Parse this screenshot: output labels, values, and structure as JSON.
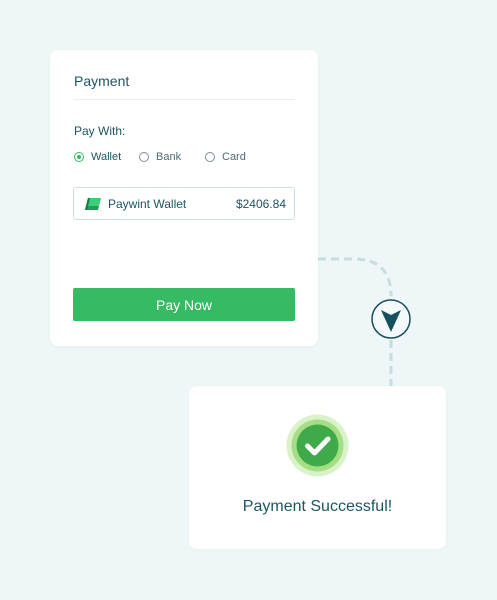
{
  "payment": {
    "title": "Payment",
    "pay_with_label": "Pay With:",
    "methods": [
      {
        "label": "Wallet",
        "selected": true
      },
      {
        "label": "Bank",
        "selected": false
      },
      {
        "label": "Card",
        "selected": false
      }
    ],
    "wallet": {
      "name": "Paywint Wallet",
      "balance": "$2406.84",
      "logo_icon": "paywint-logo-icon"
    },
    "pay_button_label": "Pay Now"
  },
  "flow": {
    "arrow_icon": "arrow-down-circle-icon"
  },
  "success": {
    "icon": "check-circle-icon",
    "message": "Payment Successful!"
  },
  "colors": {
    "background": "#eef6f7",
    "accent": "#36ba63",
    "text": "#1d5462",
    "connector": "#c5dfe0"
  }
}
